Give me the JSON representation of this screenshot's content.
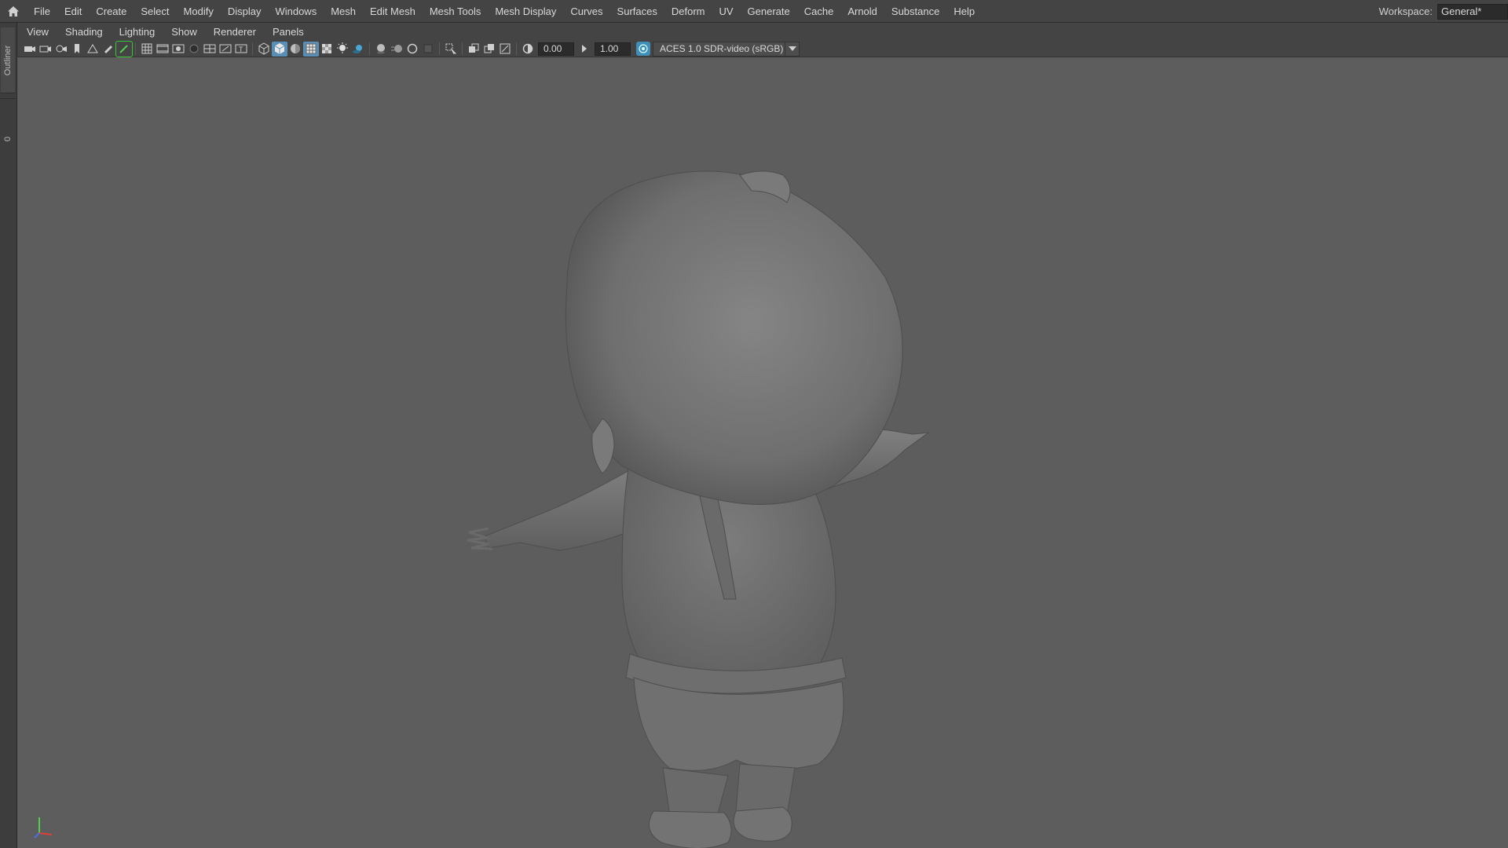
{
  "menubar": {
    "home_icon": "home-icon",
    "items": [
      "File",
      "Edit",
      "Create",
      "Select",
      "Modify",
      "Display",
      "Windows",
      "Mesh",
      "Edit Mesh",
      "Mesh Tools",
      "Mesh Display",
      "Curves",
      "Surfaces",
      "Deform",
      "UV",
      "Generate",
      "Cache",
      "Arnold",
      "Substance",
      "Help"
    ],
    "workspace_label": "Workspace:",
    "workspace_value": "General*"
  },
  "left_strip": {
    "outliner_label": "Outliner",
    "zero_label": "0"
  },
  "panel_menu": {
    "items": [
      "View",
      "Shading",
      "Lighting",
      "Show",
      "Renderer",
      "Panels"
    ]
  },
  "toolbar": {
    "exposure_value": "0.00",
    "gamma_value": "1.00",
    "colorspace_value": "ACES 1.0 SDR-video (sRGB)"
  },
  "viewport": {
    "background_color": "#5d5d5d",
    "model_color": "#7a7a7a",
    "axis_colors": {
      "x": "#e0403a",
      "y": "#4fce4f",
      "z": "#4a6fe8"
    }
  }
}
